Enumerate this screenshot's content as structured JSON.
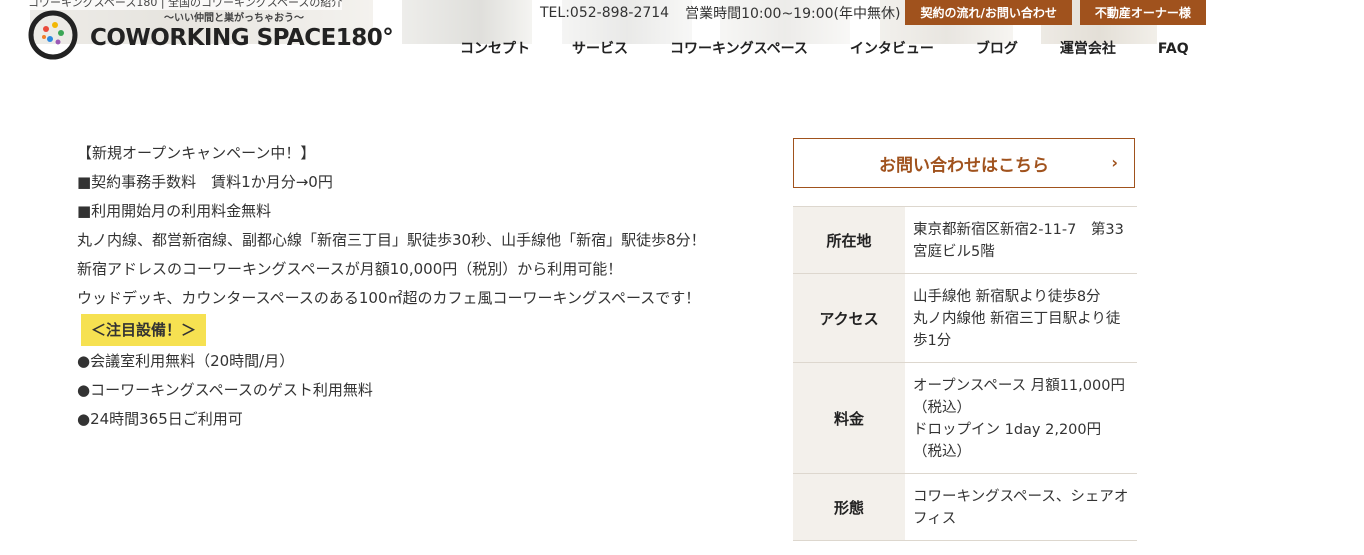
{
  "header": {
    "site_tagline": "コワーキングスペース180 | 全国のコワーキングスペースの紹介",
    "sub_tagline": "〜いい仲間と巣がっちゃおう〜",
    "logo_text": "COWORKING SPACE180°",
    "tel": "TEL:052-898-2714",
    "hours": "営業時間10:00~19:00(年中無休)",
    "contact_flow_button": "契約の流れ/お問い合わせ",
    "owner_button": "不動産オーナー様",
    "accent_color": "#a0521d"
  },
  "nav": {
    "items": [
      "コンセプト",
      "サービス",
      "コワーキングスペース",
      "インタビュー",
      "ブログ",
      "運営会社",
      "FAQ"
    ]
  },
  "content": {
    "lines": [
      "【新規オープンキャンペーン中！】",
      "■契約事務手数料　賃料1か月分→0円",
      "■利用開始月の利用料金無料",
      "丸ノ内線、都営新宿線、副都心線「新宿三丁目」駅徒歩30秒、山手線他「新宿」駅徒歩8分！",
      "新宿アドレスのコーワーキングスペースが月額10,000円（税別）から利用可能！",
      "ウッドデッキ、カウンタースペースのある100㎡超のカフェ風コーワーキングスペースです！"
    ],
    "highlight": "＜注目設備！＞",
    "features": [
      "●会議室利用無料（20時間/月）",
      "●コーワーキングスペースのゲスト利用無料",
      "●24時間365日ご利用可"
    ],
    "highlight_color": "#f6e151"
  },
  "sidebar": {
    "contact_label": "お問い合わせはこちら",
    "chevron_glyph": "›",
    "rows": [
      {
        "label": "所在地",
        "value": "東京都新宿区新宿2-11-7　第33宮庭ビル5階"
      },
      {
        "label": "アクセス",
        "value": "山手線他 新宿駅より徒歩8分\n丸ノ内線他 新宿三丁目駅より徒歩1分"
      },
      {
        "label": "料金",
        "value": "オープンスペース 月額11,000円（税込）\nドロップイン 1day 2,200円（税込）"
      },
      {
        "label": "形態",
        "value": "コワーキングスペース、シェアオフィス"
      }
    ]
  }
}
